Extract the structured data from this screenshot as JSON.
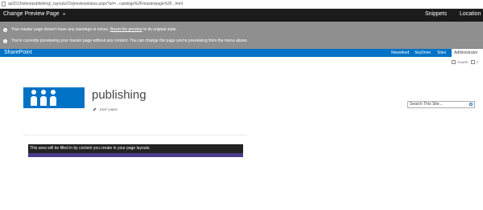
{
  "browser": {
    "url": "sp2013/sites/publishing/_layouts/15/previewstatus.aspx?url=...catalogs%2Fmasterpage%2F...html"
  },
  "topbar": {
    "change_preview": "Change Preview Page",
    "snippets": "Snippets",
    "location": "Location"
  },
  "messages": {
    "line1_a": "Your master page doesn't have any warnings or errors.",
    "line1_link": "Reset the preview",
    "line1_b": "to its original state.",
    "line2": "You're currently previewing your master page without any content. You can change the page you're previewing from the menu above."
  },
  "suitebar": {
    "brand": "SharePoint",
    "newsfeed": "Newsfeed",
    "skydrive": "SkyDrive",
    "sites": "Sites",
    "admin": "Administrator"
  },
  "actions": {
    "share": "SHARE",
    "follow": "F"
  },
  "site": {
    "title": "publishing",
    "edit_links": "EDIT LINKS"
  },
  "search": {
    "placeholder": "Search This Site..."
  },
  "content": {
    "text": "This area will be filled in by content you create in your page layouts."
  },
  "colors": {
    "suite_blue": "#0072c6",
    "top_black": "#1b1b1b",
    "message_gray": "#8f8f8f",
    "content_purple": "#4a3b8c"
  }
}
